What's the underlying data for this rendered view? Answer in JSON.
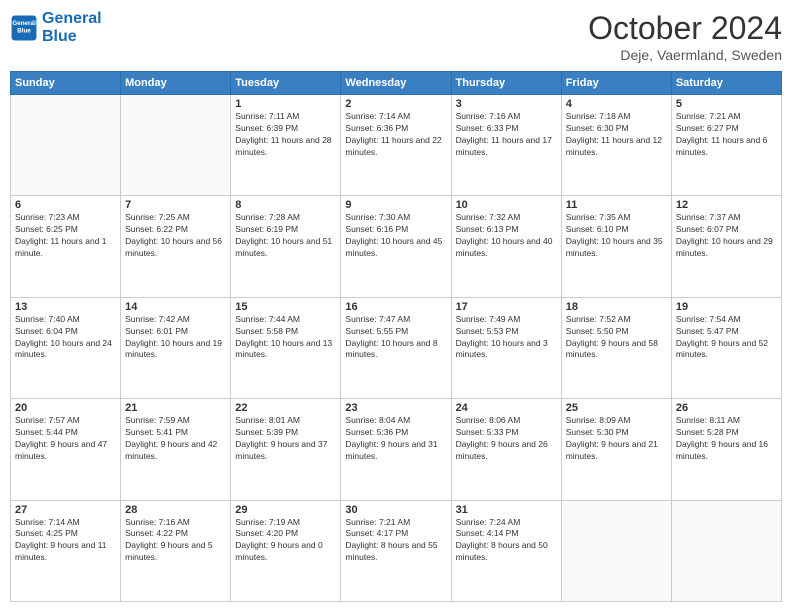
{
  "logo": {
    "line1": "General",
    "line2": "Blue"
  },
  "header": {
    "month": "October 2024",
    "location": "Deje, Vaermland, Sweden"
  },
  "days_of_week": [
    "Sunday",
    "Monday",
    "Tuesday",
    "Wednesday",
    "Thursday",
    "Friday",
    "Saturday"
  ],
  "weeks": [
    [
      {
        "day": "",
        "info": ""
      },
      {
        "day": "",
        "info": ""
      },
      {
        "day": "1",
        "info": "Sunrise: 7:11 AM\nSunset: 6:39 PM\nDaylight: 11 hours and 28 minutes."
      },
      {
        "day": "2",
        "info": "Sunrise: 7:14 AM\nSunset: 6:36 PM\nDaylight: 11 hours and 22 minutes."
      },
      {
        "day": "3",
        "info": "Sunrise: 7:16 AM\nSunset: 6:33 PM\nDaylight: 11 hours and 17 minutes."
      },
      {
        "day": "4",
        "info": "Sunrise: 7:18 AM\nSunset: 6:30 PM\nDaylight: 11 hours and 12 minutes."
      },
      {
        "day": "5",
        "info": "Sunrise: 7:21 AM\nSunset: 6:27 PM\nDaylight: 11 hours and 6 minutes."
      }
    ],
    [
      {
        "day": "6",
        "info": "Sunrise: 7:23 AM\nSunset: 6:25 PM\nDaylight: 11 hours and 1 minute."
      },
      {
        "day": "7",
        "info": "Sunrise: 7:25 AM\nSunset: 6:22 PM\nDaylight: 10 hours and 56 minutes."
      },
      {
        "day": "8",
        "info": "Sunrise: 7:28 AM\nSunset: 6:19 PM\nDaylight: 10 hours and 51 minutes."
      },
      {
        "day": "9",
        "info": "Sunrise: 7:30 AM\nSunset: 6:16 PM\nDaylight: 10 hours and 45 minutes."
      },
      {
        "day": "10",
        "info": "Sunrise: 7:32 AM\nSunset: 6:13 PM\nDaylight: 10 hours and 40 minutes."
      },
      {
        "day": "11",
        "info": "Sunrise: 7:35 AM\nSunset: 6:10 PM\nDaylight: 10 hours and 35 minutes."
      },
      {
        "day": "12",
        "info": "Sunrise: 7:37 AM\nSunset: 6:07 PM\nDaylight: 10 hours and 29 minutes."
      }
    ],
    [
      {
        "day": "13",
        "info": "Sunrise: 7:40 AM\nSunset: 6:04 PM\nDaylight: 10 hours and 24 minutes."
      },
      {
        "day": "14",
        "info": "Sunrise: 7:42 AM\nSunset: 6:01 PM\nDaylight: 10 hours and 19 minutes."
      },
      {
        "day": "15",
        "info": "Sunrise: 7:44 AM\nSunset: 5:58 PM\nDaylight: 10 hours and 13 minutes."
      },
      {
        "day": "16",
        "info": "Sunrise: 7:47 AM\nSunset: 5:55 PM\nDaylight: 10 hours and 8 minutes."
      },
      {
        "day": "17",
        "info": "Sunrise: 7:49 AM\nSunset: 5:53 PM\nDaylight: 10 hours and 3 minutes."
      },
      {
        "day": "18",
        "info": "Sunrise: 7:52 AM\nSunset: 5:50 PM\nDaylight: 9 hours and 58 minutes."
      },
      {
        "day": "19",
        "info": "Sunrise: 7:54 AM\nSunset: 5:47 PM\nDaylight: 9 hours and 52 minutes."
      }
    ],
    [
      {
        "day": "20",
        "info": "Sunrise: 7:57 AM\nSunset: 5:44 PM\nDaylight: 9 hours and 47 minutes."
      },
      {
        "day": "21",
        "info": "Sunrise: 7:59 AM\nSunset: 5:41 PM\nDaylight: 9 hours and 42 minutes."
      },
      {
        "day": "22",
        "info": "Sunrise: 8:01 AM\nSunset: 5:39 PM\nDaylight: 9 hours and 37 minutes."
      },
      {
        "day": "23",
        "info": "Sunrise: 8:04 AM\nSunset: 5:36 PM\nDaylight: 9 hours and 31 minutes."
      },
      {
        "day": "24",
        "info": "Sunrise: 8:06 AM\nSunset: 5:33 PM\nDaylight: 9 hours and 26 minutes."
      },
      {
        "day": "25",
        "info": "Sunrise: 8:09 AM\nSunset: 5:30 PM\nDaylight: 9 hours and 21 minutes."
      },
      {
        "day": "26",
        "info": "Sunrise: 8:11 AM\nSunset: 5:28 PM\nDaylight: 9 hours and 16 minutes."
      }
    ],
    [
      {
        "day": "27",
        "info": "Sunrise: 7:14 AM\nSunset: 4:25 PM\nDaylight: 9 hours and 11 minutes."
      },
      {
        "day": "28",
        "info": "Sunrise: 7:16 AM\nSunset: 4:22 PM\nDaylight: 9 hours and 5 minutes."
      },
      {
        "day": "29",
        "info": "Sunrise: 7:19 AM\nSunset: 4:20 PM\nDaylight: 9 hours and 0 minutes."
      },
      {
        "day": "30",
        "info": "Sunrise: 7:21 AM\nSunset: 4:17 PM\nDaylight: 8 hours and 55 minutes."
      },
      {
        "day": "31",
        "info": "Sunrise: 7:24 AM\nSunset: 4:14 PM\nDaylight: 8 hours and 50 minutes."
      },
      {
        "day": "",
        "info": ""
      },
      {
        "day": "",
        "info": ""
      }
    ]
  ]
}
